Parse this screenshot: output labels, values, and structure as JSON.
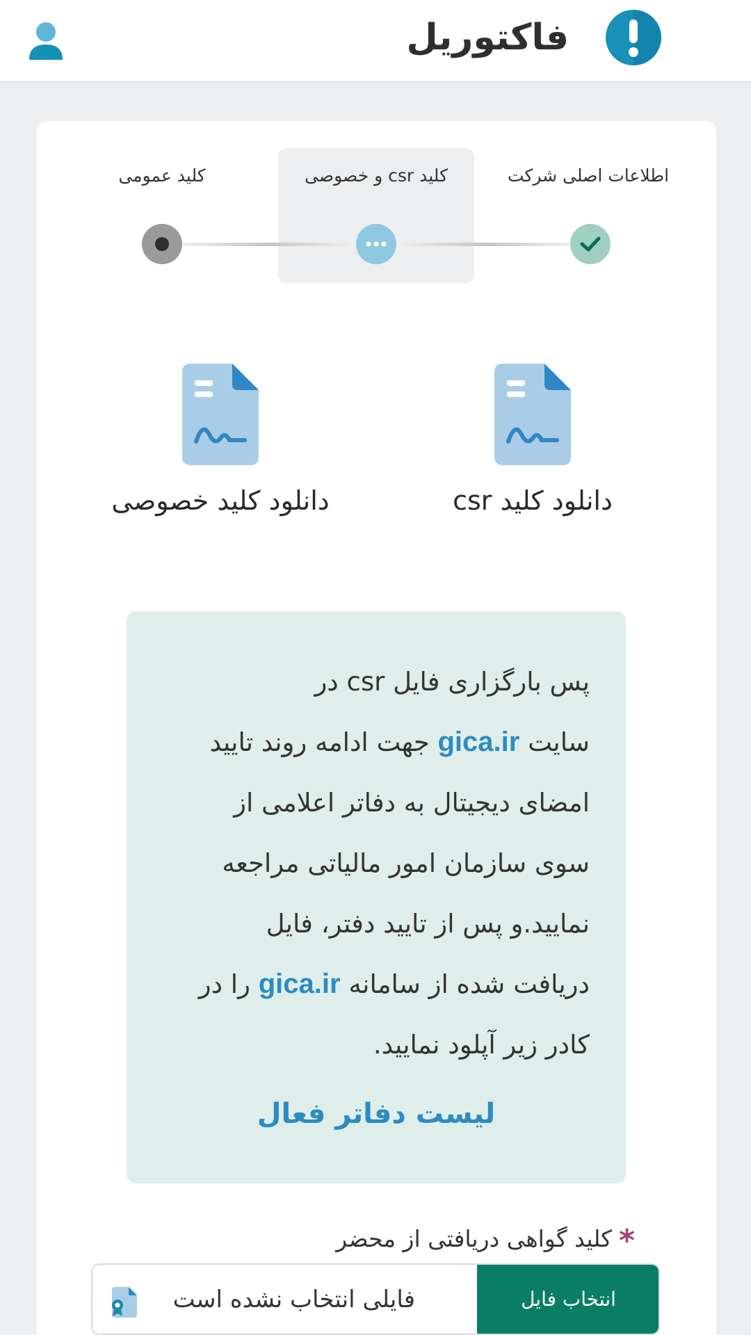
{
  "header": {
    "app_title": "فاکتوریل",
    "logo_icon": "exclamation-circle-icon",
    "user_icon": "user-icon"
  },
  "stepper": {
    "steps": [
      {
        "label": "اطلاعات اصلی شرکت",
        "state": "completed"
      },
      {
        "label": "کلید csr و خصوصی",
        "state": "active"
      },
      {
        "label": "کلید عمومی",
        "state": "pending"
      }
    ]
  },
  "downloads": {
    "csr_label": "دانلود کلید csr",
    "private_label": "دانلود کلید خصوصی"
  },
  "info": {
    "line1": "پس بارگزاری فایل csr در",
    "line2_pre": "سایت ",
    "line2_link": "gica.ir",
    "line2_post": " جهت ادامه روند تایید",
    "line3": "امضای دیجیتال به دفاتر اعلامی از",
    "line4": "سوی سازمان امور مالیاتی مراجعه",
    "line5": "نمایید.و پس از تایید دفتر، فایل",
    "line6_pre": "دریافت شده از سامانه ",
    "line6_link": "gica.ir",
    "line6_post": " را در",
    "line7": "کادر زیر آپلود نمایید.",
    "active_offices_link": "لیست دفاتر فعال"
  },
  "file_field": {
    "required_mark": "*",
    "label": "کلید گواهی دریافتی از محضر",
    "button_label": "انتخاب فایل",
    "status": "فایلی انتخاب نشده است"
  },
  "colors": {
    "primary_green": "#097e65",
    "link_blue": "#2e8bc0",
    "info_bg": "#dfeeea",
    "step_done": "#9fd0c1",
    "step_active": "#8fc9e0"
  }
}
